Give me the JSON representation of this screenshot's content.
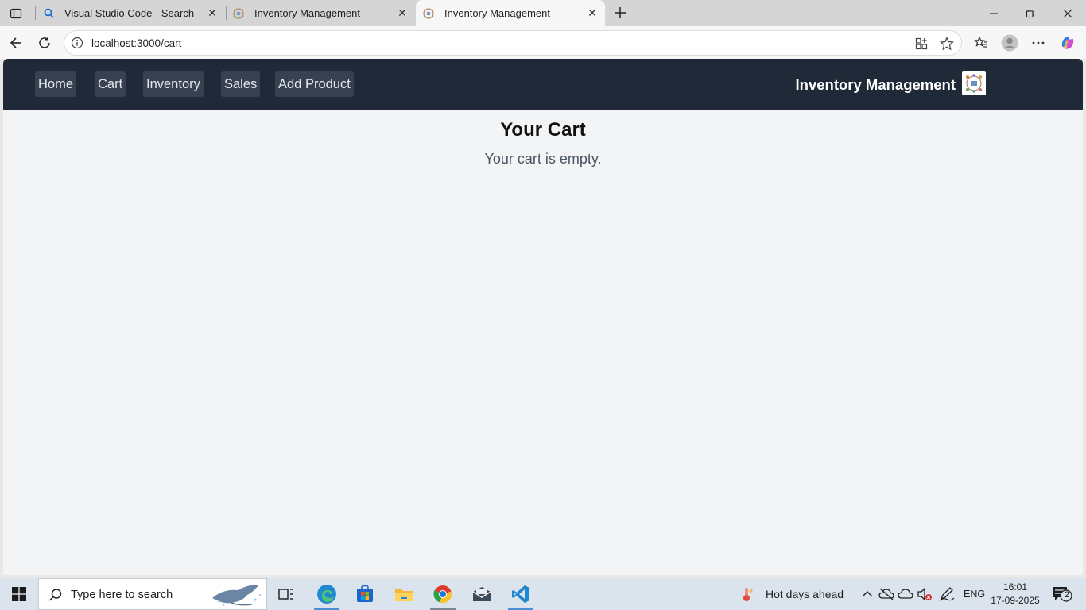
{
  "browser": {
    "tabs": [
      {
        "title": "Visual Studio Code - Search",
        "favicon": "search-icon"
      },
      {
        "title": "Inventory Management",
        "favicon": "inventory-favicon"
      },
      {
        "title": "Inventory Management",
        "favicon": "inventory-favicon",
        "active": true
      }
    ],
    "url": "localhost:3000/cart"
  },
  "page": {
    "nav_links": [
      "Home",
      "Cart",
      "Inventory",
      "Sales",
      "Add Product"
    ],
    "brand": "Inventory Management",
    "title": "Your Cart",
    "empty_message": "Your cart is empty."
  },
  "colors": {
    "navbar_bg": "#1f2937",
    "nav_link_bg": "#374151",
    "page_bg": "#f3f4f6"
  },
  "taskbar": {
    "search_placeholder": "Type here to search",
    "weather": "Hot days ahead",
    "language": "ENG",
    "time": "16:01",
    "date": "17-09-2025",
    "notification_count": "2"
  }
}
